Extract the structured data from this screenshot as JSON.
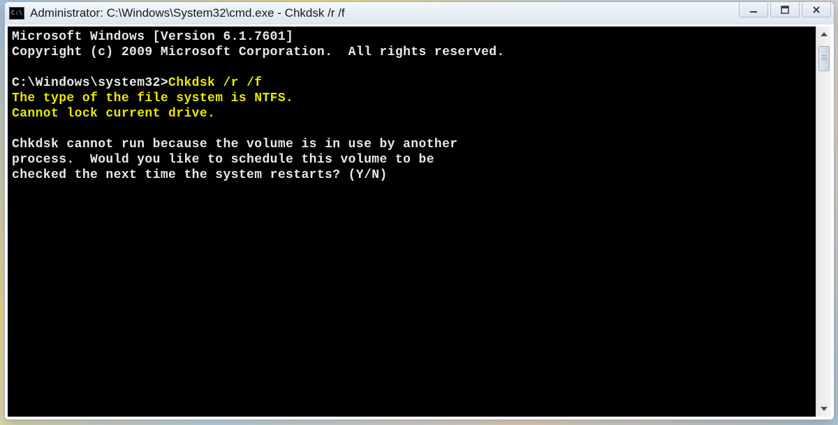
{
  "window": {
    "icon_text": "C:\\",
    "title": "Administrator: C:\\Windows\\System32\\cmd.exe - Chkdsk  /r /f"
  },
  "console": {
    "lines": [
      {
        "text": "Microsoft Windows [Version 6.1.7601]",
        "color": "white"
      },
      {
        "text": "Copyright (c) 2009 Microsoft Corporation.  All rights reserved.",
        "color": "white"
      },
      {
        "text": "",
        "color": "white"
      },
      {
        "prompt": "C:\\Windows\\system32>",
        "command": "Chkdsk /r /f"
      },
      {
        "text": "The type of the file system is NTFS.",
        "color": "yellow"
      },
      {
        "text": "Cannot lock current drive.",
        "color": "yellow"
      },
      {
        "text": "",
        "color": "white"
      },
      {
        "text": "Chkdsk cannot run because the volume is in use by another",
        "color": "white"
      },
      {
        "text": "process.  Would you like to schedule this volume to be",
        "color": "white"
      },
      {
        "text": "checked the next time the system restarts? (Y/N)",
        "color": "white"
      }
    ]
  }
}
